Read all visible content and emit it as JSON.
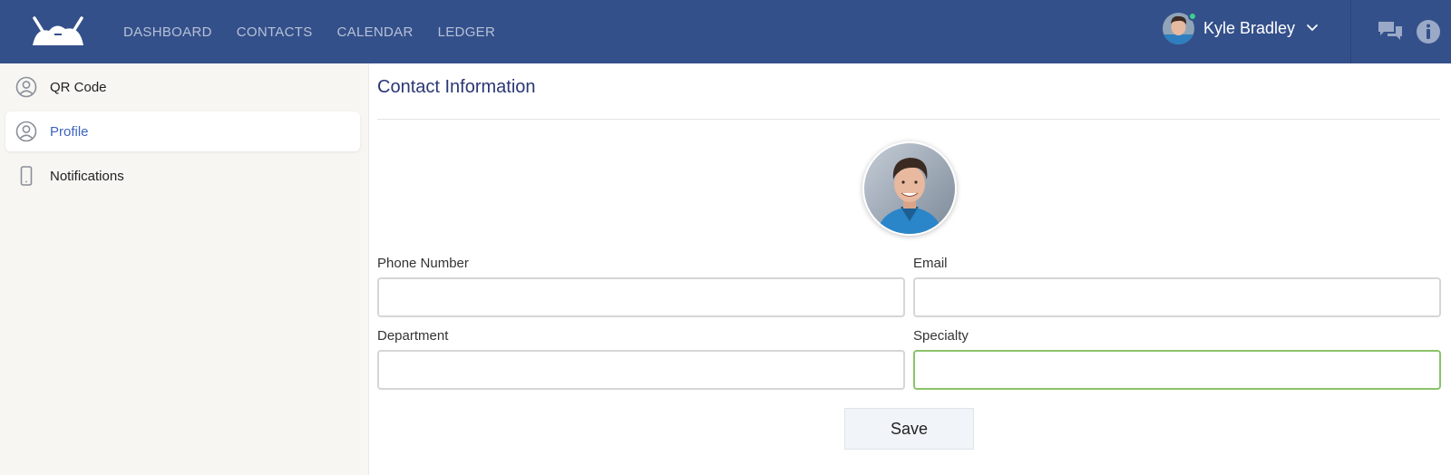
{
  "header": {
    "nav": [
      {
        "label": "DASHBOARD"
      },
      {
        "label": "CONTACTS"
      },
      {
        "label": "CALENDAR"
      },
      {
        "label": "LEDGER"
      }
    ],
    "user": {
      "name": "Kyle Bradley"
    },
    "icons": [
      "logo-icon",
      "chat-icon",
      "info-icon",
      "chevron-down-icon"
    ]
  },
  "sidebar": {
    "items": [
      {
        "label": "QR Code",
        "icon": "user-circle-icon",
        "active": false
      },
      {
        "label": "Profile",
        "icon": "user-circle-icon",
        "active": true
      },
      {
        "label": "Notifications",
        "icon": "phone-icon",
        "active": false
      }
    ]
  },
  "main": {
    "title": "Contact Information",
    "fields": {
      "phone": {
        "label": "Phone Number",
        "value": "",
        "placeholder": ""
      },
      "email": {
        "label": "Email",
        "value": "",
        "placeholder": ""
      },
      "department": {
        "label": "Department",
        "value": "",
        "placeholder": ""
      },
      "specialty": {
        "label": "Specialty",
        "value": "",
        "placeholder": ""
      }
    },
    "save_label": "Save"
  },
  "colors": {
    "header_bg": "#34508a",
    "accent": "#3d64c4",
    "title": "#2a3775",
    "focus_border": "#8bc26a",
    "online": "#3ecf8e"
  }
}
